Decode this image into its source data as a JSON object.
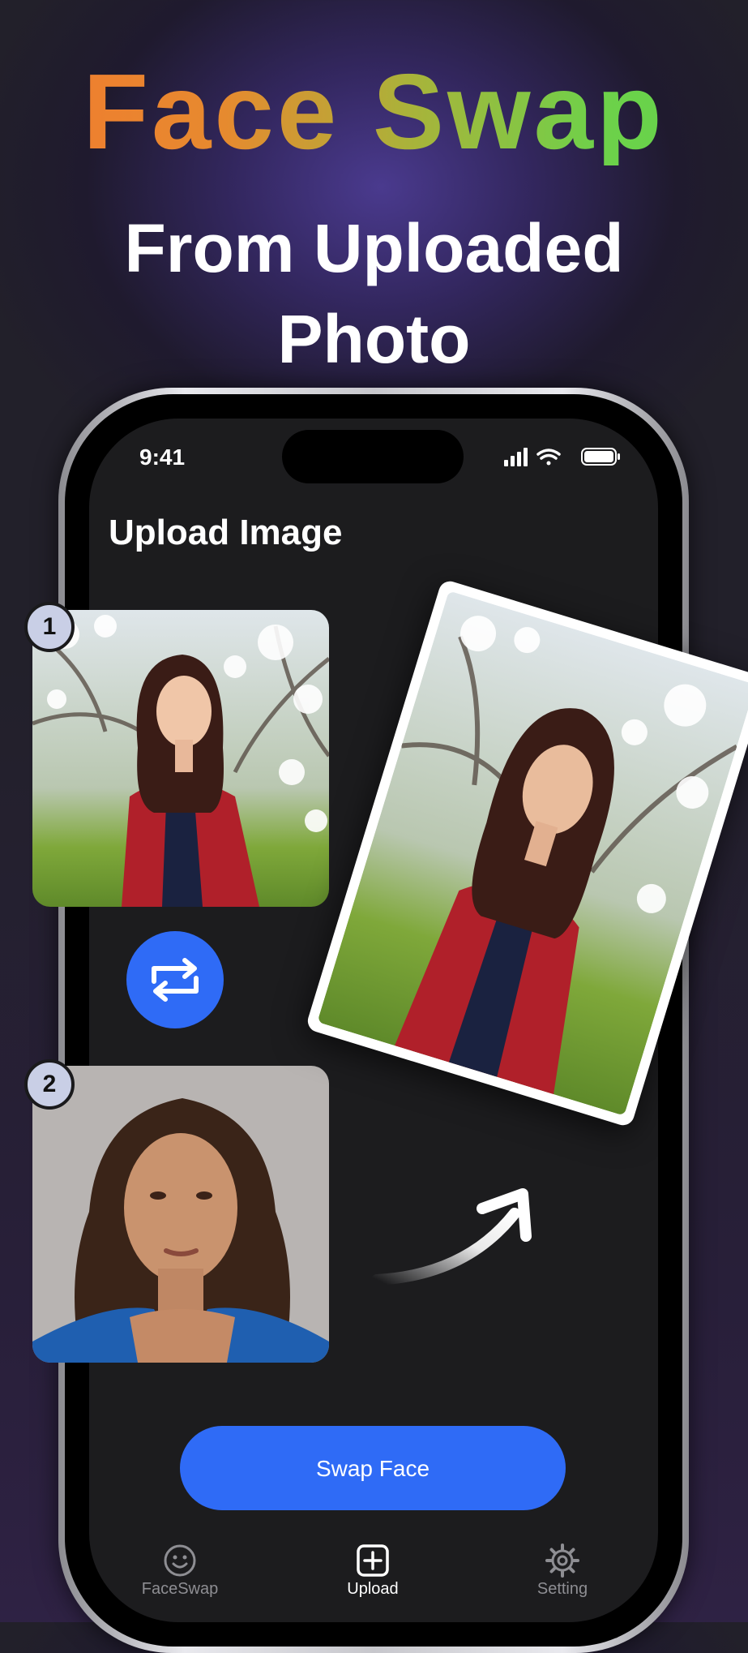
{
  "promo": {
    "title": "Face Swap",
    "subtitle_line1": "From Uploaded",
    "subtitle_line2": "Photo"
  },
  "status_bar": {
    "time": "9:41",
    "icons": [
      "cellular-signal-icon",
      "wifi-icon",
      "battery-icon"
    ]
  },
  "screen": {
    "title": "Upload Image",
    "steps": [
      {
        "number": "1",
        "image": "woman-red-cardigan-photo"
      },
      {
        "number": "2",
        "image": "woman-curly-hair-portrait"
      }
    ],
    "swap_icon": "swap-arrows-icon",
    "result_image": "swapped-result-photo",
    "action_button": "Swap Face"
  },
  "tab_bar": {
    "items": [
      {
        "label": "FaceSwap",
        "icon": "smiley-face-icon",
        "active": false
      },
      {
        "label": "Upload",
        "icon": "plus-square-icon",
        "active": true
      },
      {
        "label": "Setting",
        "icon": "gear-icon",
        "active": false
      }
    ]
  },
  "colors": {
    "accent_blue": "#2f6bf6",
    "title_orange": "#f27a2f",
    "title_green": "#5fd44c",
    "screen_bg": "#1c1c1e",
    "inactive_tab": "#8e8e93"
  }
}
